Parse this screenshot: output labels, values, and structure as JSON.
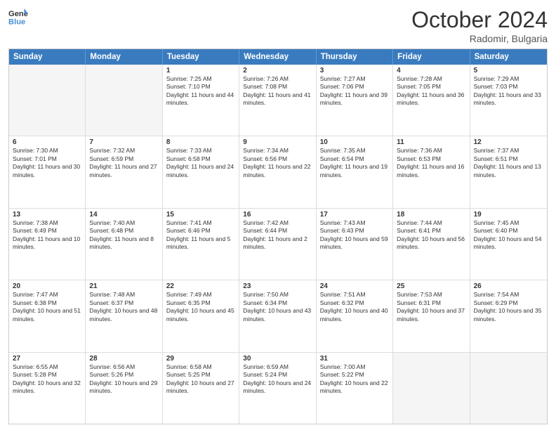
{
  "header": {
    "logo_line1": "General",
    "logo_line2": "Blue",
    "month": "October 2024",
    "location": "Radomir, Bulgaria"
  },
  "weekdays": [
    "Sunday",
    "Monday",
    "Tuesday",
    "Wednesday",
    "Thursday",
    "Friday",
    "Saturday"
  ],
  "rows": [
    [
      {
        "day": "",
        "empty": true
      },
      {
        "day": "",
        "empty": true
      },
      {
        "day": "1",
        "sunrise": "Sunrise: 7:25 AM",
        "sunset": "Sunset: 7:10 PM",
        "daylight": "Daylight: 11 hours and 44 minutes."
      },
      {
        "day": "2",
        "sunrise": "Sunrise: 7:26 AM",
        "sunset": "Sunset: 7:08 PM",
        "daylight": "Daylight: 11 hours and 41 minutes."
      },
      {
        "day": "3",
        "sunrise": "Sunrise: 7:27 AM",
        "sunset": "Sunset: 7:06 PM",
        "daylight": "Daylight: 11 hours and 39 minutes."
      },
      {
        "day": "4",
        "sunrise": "Sunrise: 7:28 AM",
        "sunset": "Sunset: 7:05 PM",
        "daylight": "Daylight: 11 hours and 36 minutes."
      },
      {
        "day": "5",
        "sunrise": "Sunrise: 7:29 AM",
        "sunset": "Sunset: 7:03 PM",
        "daylight": "Daylight: 11 hours and 33 minutes."
      }
    ],
    [
      {
        "day": "6",
        "sunrise": "Sunrise: 7:30 AM",
        "sunset": "Sunset: 7:01 PM",
        "daylight": "Daylight: 11 hours and 30 minutes."
      },
      {
        "day": "7",
        "sunrise": "Sunrise: 7:32 AM",
        "sunset": "Sunset: 6:59 PM",
        "daylight": "Daylight: 11 hours and 27 minutes."
      },
      {
        "day": "8",
        "sunrise": "Sunrise: 7:33 AM",
        "sunset": "Sunset: 6:58 PM",
        "daylight": "Daylight: 11 hours and 24 minutes."
      },
      {
        "day": "9",
        "sunrise": "Sunrise: 7:34 AM",
        "sunset": "Sunset: 6:56 PM",
        "daylight": "Daylight: 11 hours and 22 minutes."
      },
      {
        "day": "10",
        "sunrise": "Sunrise: 7:35 AM",
        "sunset": "Sunset: 6:54 PM",
        "daylight": "Daylight: 11 hours and 19 minutes."
      },
      {
        "day": "11",
        "sunrise": "Sunrise: 7:36 AM",
        "sunset": "Sunset: 6:53 PM",
        "daylight": "Daylight: 11 hours and 16 minutes."
      },
      {
        "day": "12",
        "sunrise": "Sunrise: 7:37 AM",
        "sunset": "Sunset: 6:51 PM",
        "daylight": "Daylight: 11 hours and 13 minutes."
      }
    ],
    [
      {
        "day": "13",
        "sunrise": "Sunrise: 7:38 AM",
        "sunset": "Sunset: 6:49 PM",
        "daylight": "Daylight: 11 hours and 10 minutes."
      },
      {
        "day": "14",
        "sunrise": "Sunrise: 7:40 AM",
        "sunset": "Sunset: 6:48 PM",
        "daylight": "Daylight: 11 hours and 8 minutes."
      },
      {
        "day": "15",
        "sunrise": "Sunrise: 7:41 AM",
        "sunset": "Sunset: 6:46 PM",
        "daylight": "Daylight: 11 hours and 5 minutes."
      },
      {
        "day": "16",
        "sunrise": "Sunrise: 7:42 AM",
        "sunset": "Sunset: 6:44 PM",
        "daylight": "Daylight: 11 hours and 2 minutes."
      },
      {
        "day": "17",
        "sunrise": "Sunrise: 7:43 AM",
        "sunset": "Sunset: 6:43 PM",
        "daylight": "Daylight: 10 hours and 59 minutes."
      },
      {
        "day": "18",
        "sunrise": "Sunrise: 7:44 AM",
        "sunset": "Sunset: 6:41 PM",
        "daylight": "Daylight: 10 hours and 56 minutes."
      },
      {
        "day": "19",
        "sunrise": "Sunrise: 7:45 AM",
        "sunset": "Sunset: 6:40 PM",
        "daylight": "Daylight: 10 hours and 54 minutes."
      }
    ],
    [
      {
        "day": "20",
        "sunrise": "Sunrise: 7:47 AM",
        "sunset": "Sunset: 6:38 PM",
        "daylight": "Daylight: 10 hours and 51 minutes."
      },
      {
        "day": "21",
        "sunrise": "Sunrise: 7:48 AM",
        "sunset": "Sunset: 6:37 PM",
        "daylight": "Daylight: 10 hours and 48 minutes."
      },
      {
        "day": "22",
        "sunrise": "Sunrise: 7:49 AM",
        "sunset": "Sunset: 6:35 PM",
        "daylight": "Daylight: 10 hours and 45 minutes."
      },
      {
        "day": "23",
        "sunrise": "Sunrise: 7:50 AM",
        "sunset": "Sunset: 6:34 PM",
        "daylight": "Daylight: 10 hours and 43 minutes."
      },
      {
        "day": "24",
        "sunrise": "Sunrise: 7:51 AM",
        "sunset": "Sunset: 6:32 PM",
        "daylight": "Daylight: 10 hours and 40 minutes."
      },
      {
        "day": "25",
        "sunrise": "Sunrise: 7:53 AM",
        "sunset": "Sunset: 6:31 PM",
        "daylight": "Daylight: 10 hours and 37 minutes."
      },
      {
        "day": "26",
        "sunrise": "Sunrise: 7:54 AM",
        "sunset": "Sunset: 6:29 PM",
        "daylight": "Daylight: 10 hours and 35 minutes."
      }
    ],
    [
      {
        "day": "27",
        "sunrise": "Sunrise: 6:55 AM",
        "sunset": "Sunset: 5:28 PM",
        "daylight": "Daylight: 10 hours and 32 minutes."
      },
      {
        "day": "28",
        "sunrise": "Sunrise: 6:56 AM",
        "sunset": "Sunset: 5:26 PM",
        "daylight": "Daylight: 10 hours and 29 minutes."
      },
      {
        "day": "29",
        "sunrise": "Sunrise: 6:58 AM",
        "sunset": "Sunset: 5:25 PM",
        "daylight": "Daylight: 10 hours and 27 minutes."
      },
      {
        "day": "30",
        "sunrise": "Sunrise: 6:59 AM",
        "sunset": "Sunset: 5:24 PM",
        "daylight": "Daylight: 10 hours and 24 minutes."
      },
      {
        "day": "31",
        "sunrise": "Sunrise: 7:00 AM",
        "sunset": "Sunset: 5:22 PM",
        "daylight": "Daylight: 10 hours and 22 minutes."
      },
      {
        "day": "",
        "empty": true
      },
      {
        "day": "",
        "empty": true
      }
    ]
  ]
}
